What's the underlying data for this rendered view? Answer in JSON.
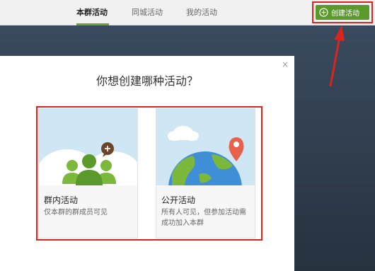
{
  "nav": {
    "tabs": [
      {
        "label": "本群活动",
        "active": true
      },
      {
        "label": "同城活动",
        "active": false
      },
      {
        "label": "我的活动",
        "active": false
      }
    ],
    "create_label": "创建活动"
  },
  "modal": {
    "title": "你想创建哪种活动？",
    "close": "×",
    "cards": [
      {
        "title": "群内活动",
        "desc": "仅本群的群成员可见"
      },
      {
        "title": "公开活动",
        "desc": "所有人可见，但参加活动需成功加入本群"
      }
    ]
  },
  "colors": {
    "accent_green": "#5a9a2b",
    "highlight_red": "#d9251d"
  }
}
